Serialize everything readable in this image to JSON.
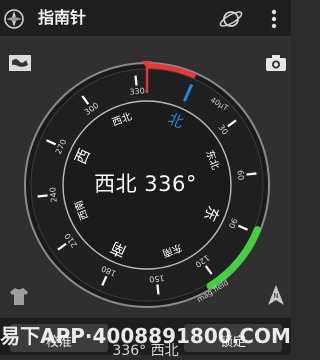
{
  "app": {
    "title": "指南针"
  },
  "icons": {
    "app": "compass-app-icon",
    "planet": "planet-icon",
    "menu": "overflow-menu-icon",
    "map": "map-icon",
    "camera": "camera-icon",
    "shirt": "shirt-icon",
    "north_arrow": "north-arrow-icon"
  },
  "compass": {
    "heading_degrees": 336,
    "heading_direction": "西北",
    "readout": "西北 336°",
    "cardinals": {
      "north": "北",
      "east": "东",
      "south": "南",
      "west": "西"
    },
    "intercardinals": {
      "northeast": "东北",
      "southeast": "东南",
      "southwest": "西南",
      "northwest": "西北"
    },
    "degree_labels": [
      "30",
      "60",
      "90",
      "120",
      "150",
      "180",
      "210",
      "240",
      "270",
      "300",
      "330"
    ],
    "magnetic_field_label": "40μT",
    "magnetic_field_caption": "mag.field",
    "colors": {
      "north": "#1e88e5",
      "heading_arc": "#e53935",
      "field_arc": "#43d13f"
    }
  },
  "bottom": {
    "calibrate_label": "校准",
    "lock_label": "锁定",
    "heading_text": "336° 西北"
  },
  "watermark": "易下APP·4008891800.COM"
}
